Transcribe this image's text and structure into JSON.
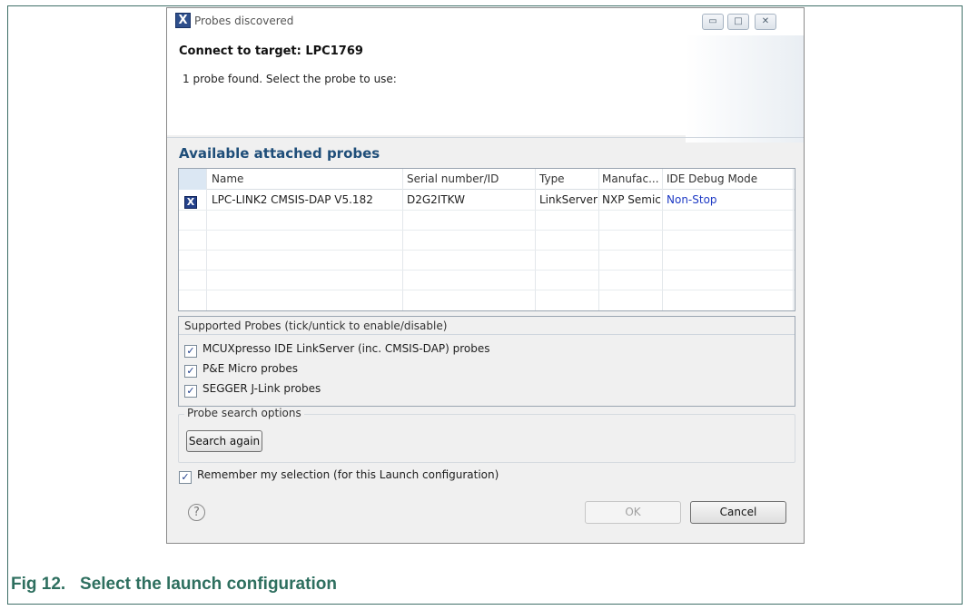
{
  "figure": {
    "caption": "Fig 12.   Select the launch configuration"
  },
  "dialog": {
    "title": "Probes discovered",
    "app_icon": "X",
    "window_buttons": {
      "minimize": "▭",
      "maximize": "□",
      "close": "✕"
    },
    "connect_title": "Connect to target: LPC1769",
    "connect_msg": "1 probe found. Select the probe to use:",
    "section_title": "Available attached probes",
    "table": {
      "columns": [
        "Name",
        "Serial number/ID",
        "Type",
        "Manufac...",
        "IDE Debug Mode"
      ],
      "rows": [
        {
          "icon": "X",
          "name": "LPC-LINK2 CMSIS-DAP V5.182",
          "serial": "D2G2ITKW",
          "type": "LinkServer",
          "manufacturer": "NXP Semic",
          "mode": "Non-Stop"
        }
      ]
    },
    "supported": {
      "heading": "Supported Probes (tick/untick to enable/disable)",
      "items": [
        {
          "label": "MCUXpresso IDE LinkServer (inc. CMSIS-DAP) probes",
          "checked": true
        },
        {
          "label": "P&E Micro probes",
          "checked": true
        },
        {
          "label": "SEGGER J-Link probes",
          "checked": true
        }
      ]
    },
    "search": {
      "legend": "Probe search options",
      "button": "Search again"
    },
    "remember": {
      "label": "Remember my selection (for this Launch configuration)",
      "checked": true
    },
    "footer": {
      "help_icon": "?",
      "ok_label": "OK",
      "cancel_label": "Cancel"
    },
    "check_glyph": "✓",
    "colors": {
      "accent_title": "#1f4e79",
      "link": "#1d39c4",
      "caption": "#2e6f5f"
    }
  }
}
